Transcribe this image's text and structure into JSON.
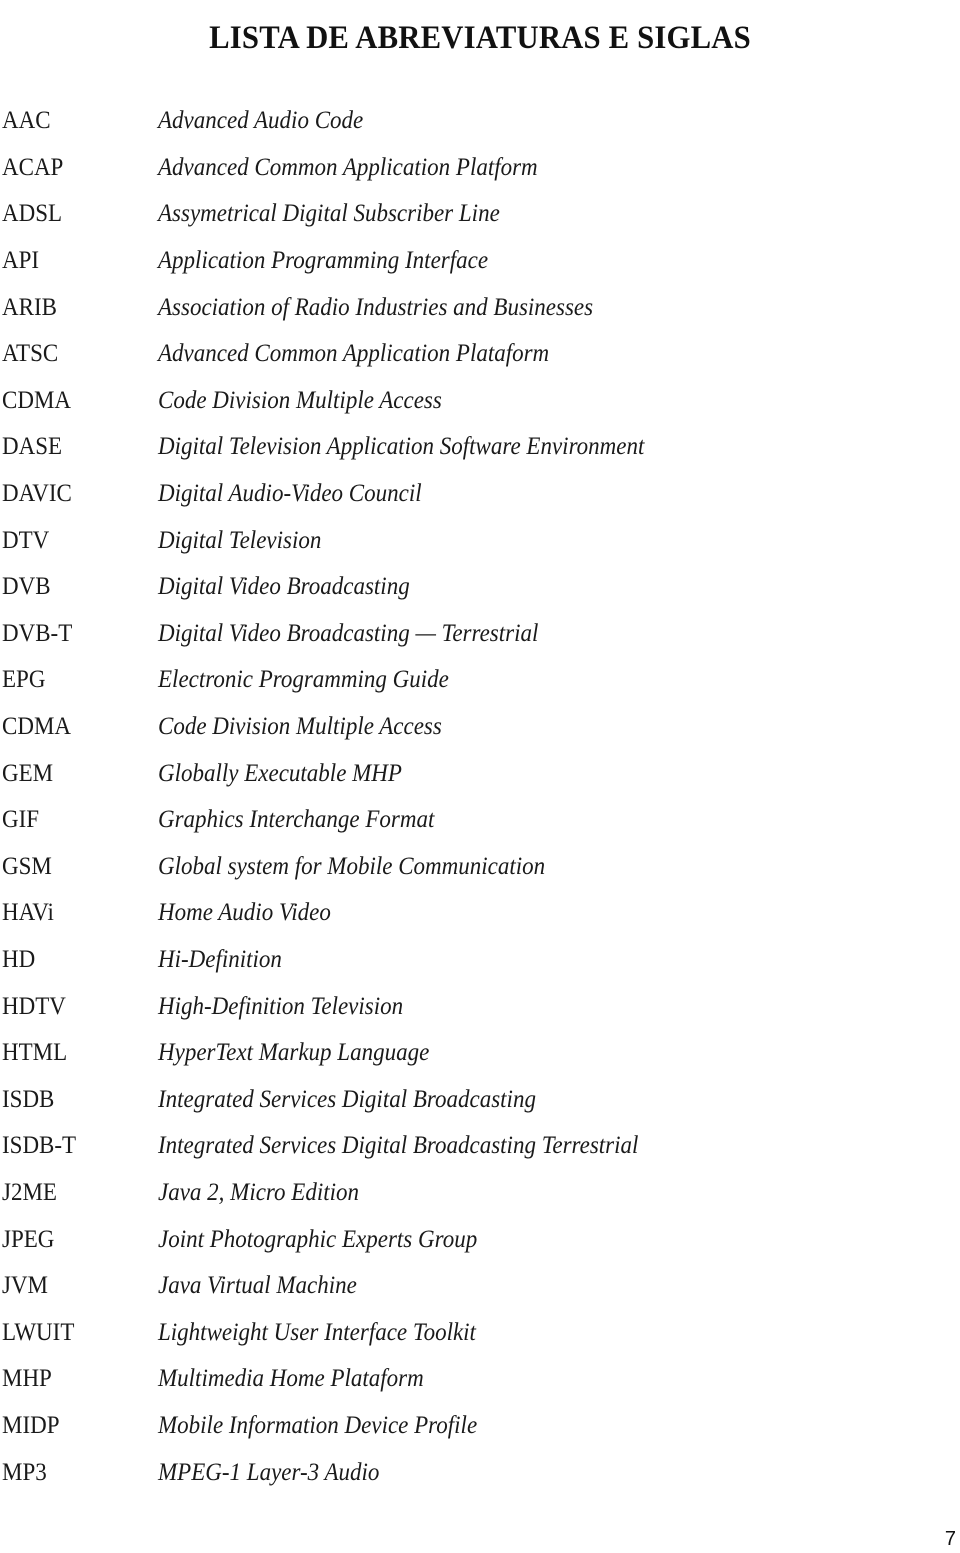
{
  "document": {
    "title": "LISTA DE ABREVIATURAS E SIGLAS",
    "page_number": "7",
    "entries": [
      {
        "abbr": "AAC",
        "definition": "Advanced Audio Code"
      },
      {
        "abbr": "ACAP",
        "definition": "Advanced Common Application Platform"
      },
      {
        "abbr": "ADSL",
        "definition": "Assymetrical Digital Subscriber Line"
      },
      {
        "abbr": "API",
        "definition": "Application Programming Interface"
      },
      {
        "abbr": "ARIB",
        "definition": "Association of Radio Industries and Businesses"
      },
      {
        "abbr": "ATSC",
        "definition": "Advanced Common Application Plataform"
      },
      {
        "abbr": "CDMA",
        "definition": "Code Division Multiple Access"
      },
      {
        "abbr": "DASE",
        "definition": "Digital Television Application Software Environment"
      },
      {
        "abbr": "DAVIC",
        "definition": "Digital Audio-Video Council"
      },
      {
        "abbr": "DTV",
        "definition": "Digital Television"
      },
      {
        "abbr": "DVB",
        "definition": "Digital Video Broadcasting"
      },
      {
        "abbr": "DVB-T",
        "definition": "Digital Video Broadcasting — Terrestrial"
      },
      {
        "abbr": "EPG",
        "definition": "Electronic Programming Guide"
      },
      {
        "abbr": "CDMA",
        "definition": "Code Division Multiple Access"
      },
      {
        "abbr": "GEM",
        "definition": "Globally Executable MHP"
      },
      {
        "abbr": "GIF",
        "definition": "Graphics Interchange Format"
      },
      {
        "abbr": "GSM",
        "definition": "Global system for Mobile Communication"
      },
      {
        "abbr": "HAVi",
        "definition": "Home Audio Video"
      },
      {
        "abbr": "HD",
        "definition": "Hi-Definition"
      },
      {
        "abbr": "HDTV",
        "definition": "High-Definition Television"
      },
      {
        "abbr": "HTML",
        "definition": "HyperText Markup Language"
      },
      {
        "abbr": "ISDB",
        "definition": "Integrated Services Digital Broadcasting"
      },
      {
        "abbr": "ISDB-T",
        "definition": "Integrated Services Digital Broadcasting Terrestrial"
      },
      {
        "abbr": "J2ME",
        "definition": "Java 2, Micro Edition"
      },
      {
        "abbr": "JPEG",
        "definition": "Joint Photographic Experts Group"
      },
      {
        "abbr": "JVM",
        "definition": "Java Virtual Machine"
      },
      {
        "abbr": "LWUIT",
        "definition": "Lightweight User Interface Toolkit"
      },
      {
        "abbr": "MHP",
        "definition": "Multimedia Home Plataform"
      },
      {
        "abbr": "MIDP",
        "definition": "Mobile Information Device Profile"
      },
      {
        "abbr": "MP3",
        "definition": "MPEG-1 Layer-3 Audio"
      }
    ]
  }
}
